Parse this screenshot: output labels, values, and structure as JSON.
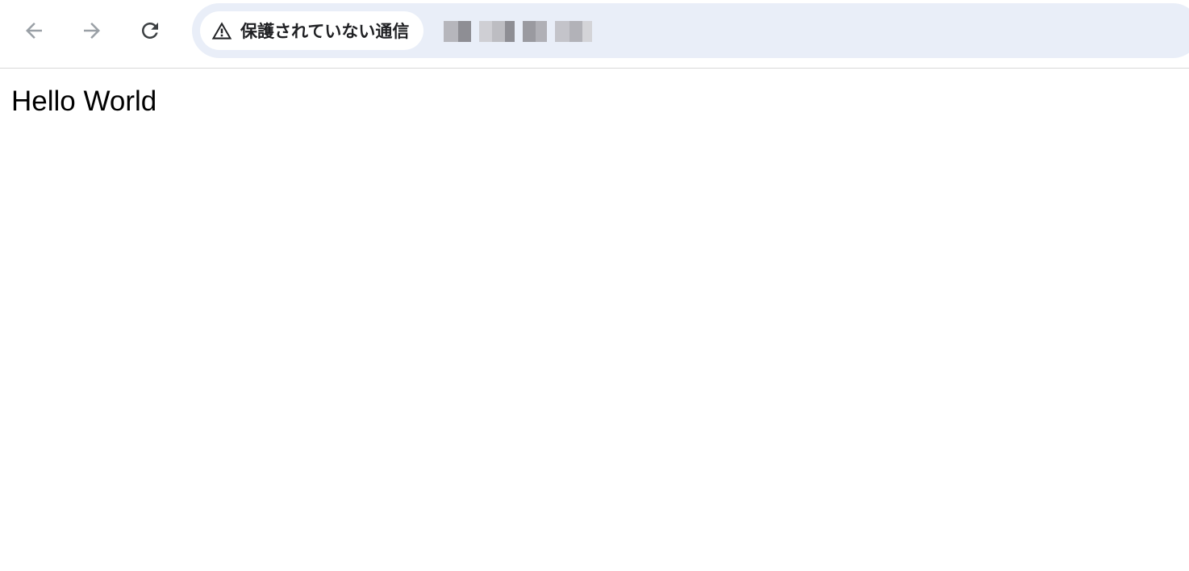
{
  "toolbar": {
    "back_icon": "arrow-left-icon",
    "forward_icon": "arrow-right-icon",
    "reload_icon": "reload-icon",
    "security": {
      "icon": "warning-triangle-icon",
      "label": "保護されていない通信"
    },
    "url_obscured": true
  },
  "page": {
    "text": "Hello World"
  },
  "colors": {
    "omnibox_bg": "#e9eef8",
    "nav_icon_disabled": "#9aa0a6",
    "nav_icon_enabled": "#3c4043"
  }
}
